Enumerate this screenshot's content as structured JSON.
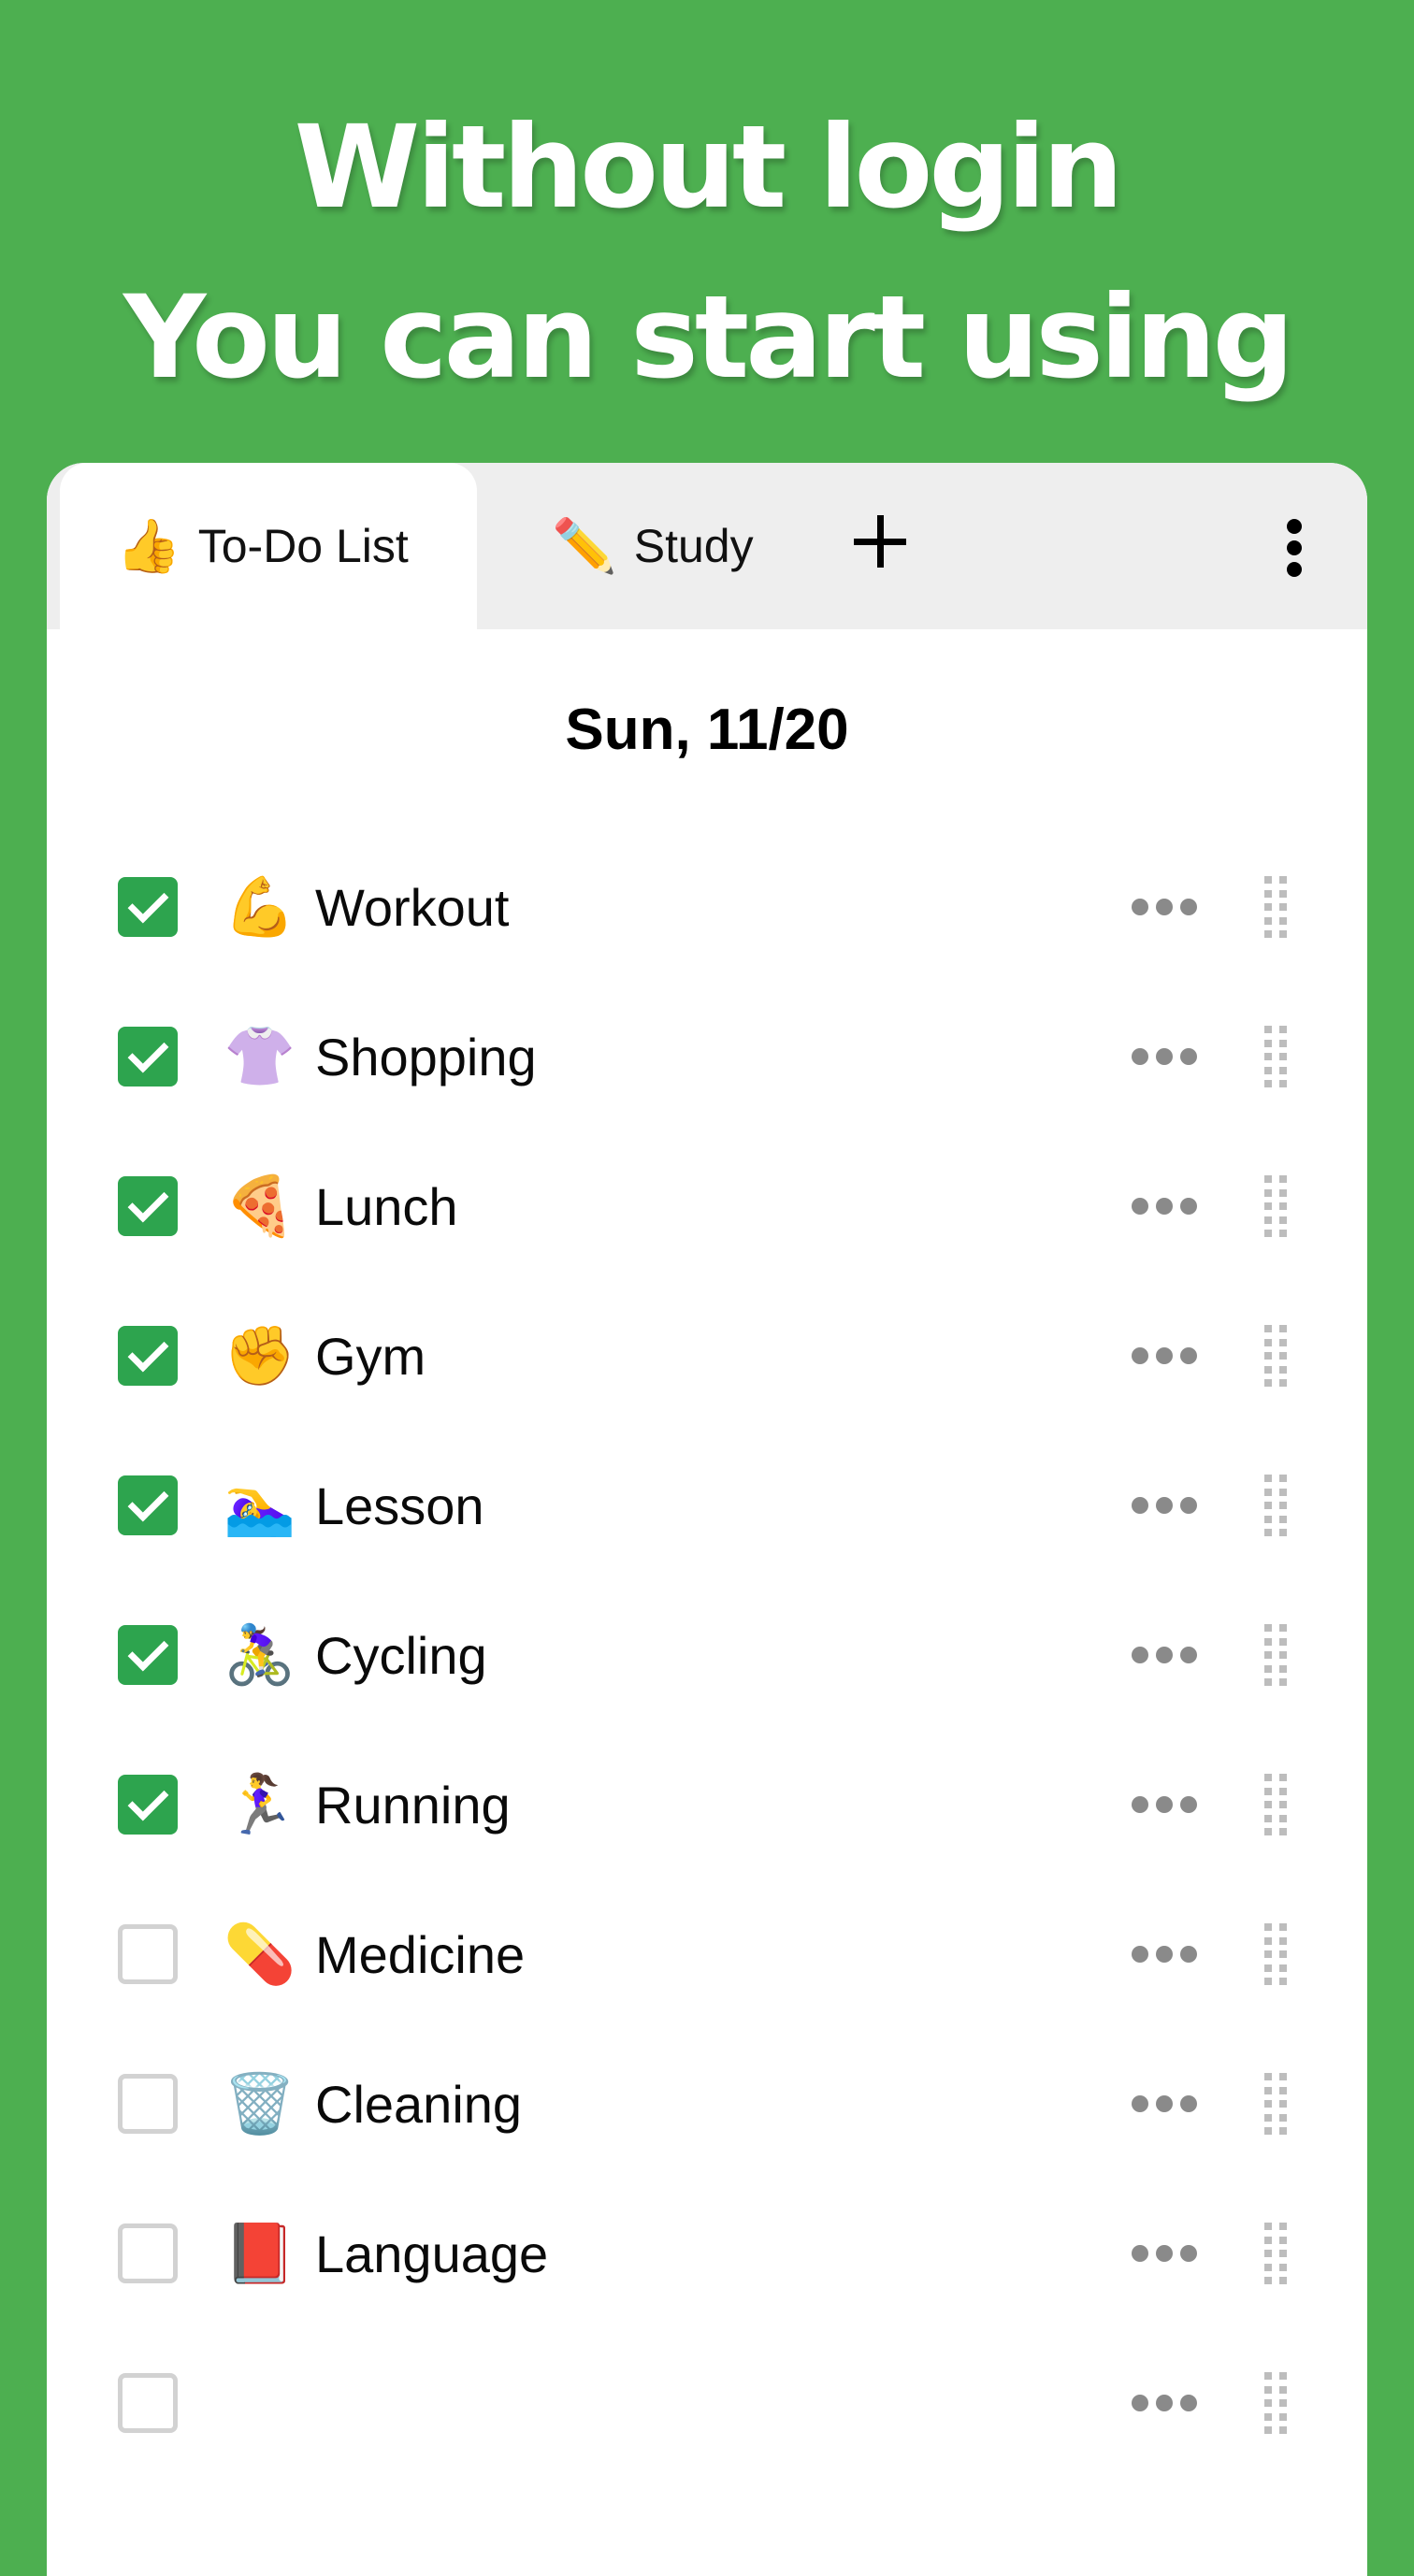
{
  "headline": {
    "line1": "Without login",
    "line2": "You can start using"
  },
  "tabs": [
    {
      "emoji": "👍",
      "label": "To-Do List",
      "active": true
    },
    {
      "emoji": "✏️",
      "label": "Study",
      "active": false
    }
  ],
  "tabbar": {
    "add_icon": "plus-icon",
    "menu_icon": "vertical-ellipsis-icon"
  },
  "date_header": "Sun, 11/20",
  "items": [
    {
      "emoji": "💪",
      "label": "Workout",
      "checked": true
    },
    {
      "emoji": "👚",
      "label": "Shopping",
      "checked": true
    },
    {
      "emoji": "🍕",
      "label": "Lunch",
      "checked": true
    },
    {
      "emoji": "✊",
      "label": "Gym",
      "checked": true
    },
    {
      "emoji": "🏊‍♀️",
      "label": "Lesson",
      "checked": true
    },
    {
      "emoji": "🚴‍♀️",
      "label": "Cycling",
      "checked": true
    },
    {
      "emoji": "🏃‍♀️",
      "label": "Running",
      "checked": true
    },
    {
      "emoji": "💊",
      "label": "Medicine",
      "checked": false
    },
    {
      "emoji": "🗑️",
      "label": "Cleaning",
      "checked": false
    },
    {
      "emoji": "📕",
      "label": "Language",
      "checked": false
    },
    {
      "emoji": "",
      "label": "",
      "checked": false
    }
  ],
  "colors": {
    "background": "#4DAF50",
    "checkbox_checked": "#2DA44E",
    "checkbox_unchecked_border": "#D2D2D2",
    "tabbar_bg": "#EEEEEE",
    "row_more_dots": "#8A8A8A",
    "drag_handle": "#BDBDBD"
  }
}
